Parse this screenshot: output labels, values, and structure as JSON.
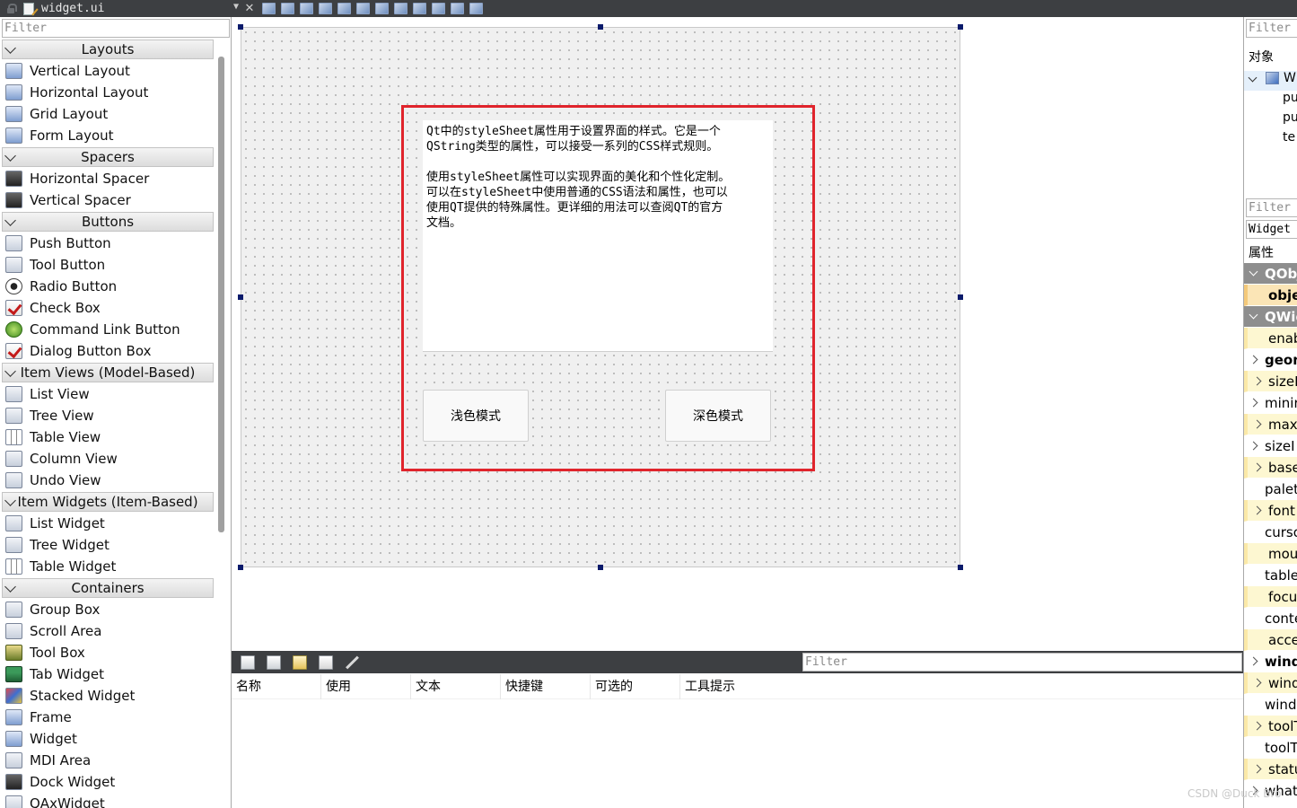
{
  "topbar": {
    "file_name": "widget.ui",
    "close_symbol": "✕"
  },
  "widget_box": {
    "filter_placeholder": "Filter",
    "categories": [
      {
        "title": "Layouts",
        "items": [
          "Vertical Layout",
          "Horizontal Layout",
          "Grid Layout",
          "Form Layout"
        ]
      },
      {
        "title": "Spacers",
        "items": [
          "Horizontal Spacer",
          "Vertical Spacer"
        ]
      },
      {
        "title": "Buttons",
        "items": [
          "Push Button",
          "Tool Button",
          "Radio Button",
          "Check Box",
          "Command Link Button",
          "Dialog Button Box"
        ]
      },
      {
        "title": "Item Views (Model-Based)",
        "items": [
          "List View",
          "Tree View",
          "Table View",
          "Column View",
          "Undo View"
        ]
      },
      {
        "title": "Item Widgets (Item-Based)",
        "items": [
          "List Widget",
          "Tree Widget",
          "Table Widget"
        ]
      },
      {
        "title": "Containers",
        "items": [
          "Group Box",
          "Scroll Area",
          "Tool Box",
          "Tab Widget",
          "Stacked Widget",
          "Frame",
          "Widget",
          "MDI Area",
          "Dock Widget",
          "QAxWidget"
        ]
      }
    ]
  },
  "form": {
    "text_content": "Qt中的styleSheet属性用于设置界面的样式。它是一个\nQString类型的属性，可以接受一系列的CSS样式规则。\n\n使用styleSheet属性可以实现界面的美化和个性化定制。\n可以在styleSheet中使用普通的CSS语法和属性，也可以\n使用QT提供的特殊属性。更详细的用法可以查阅QT的官方\n文档。",
    "light_button": "浅色模式",
    "dark_button": "深色模式",
    "highlight_color": "#e0242c"
  },
  "action_editor": {
    "filter_placeholder": "Filter",
    "columns": [
      "名称",
      "使用",
      "文本",
      "快捷键",
      "可选的",
      "工具提示"
    ]
  },
  "object_inspector": {
    "filter_placeholder": "Filter",
    "header": "对象",
    "rows": [
      "W",
      "pu",
      "pu",
      "te"
    ]
  },
  "property_editor": {
    "filter_placeholder": "Filter",
    "class_name": "Widget",
    "header": "属性",
    "rows": [
      {
        "label": "QObj",
        "kind": "group"
      },
      {
        "label": "obje",
        "kind": "orange"
      },
      {
        "label": "QWid",
        "kind": "group"
      },
      {
        "label": "enab",
        "kind": "yellow"
      },
      {
        "label": "geon",
        "kind": "bold-expand"
      },
      {
        "label": "sizeP",
        "kind": "yellow-expand"
      },
      {
        "label": "minir",
        "kind": "expand"
      },
      {
        "label": "maxi",
        "kind": "yellow-expand"
      },
      {
        "label": "sizeI",
        "kind": "expand"
      },
      {
        "label": "base",
        "kind": "yellow-expand"
      },
      {
        "label": "palet",
        "kind": "plain"
      },
      {
        "label": "font",
        "kind": "yellow-expand"
      },
      {
        "label": "curso",
        "kind": "plain"
      },
      {
        "label": "mous",
        "kind": "yellow"
      },
      {
        "label": "table",
        "kind": "plain"
      },
      {
        "label": "focus",
        "kind": "yellow"
      },
      {
        "label": "conte",
        "kind": "plain"
      },
      {
        "label": "accep",
        "kind": "yellow"
      },
      {
        "label": "wind",
        "kind": "bold-expand"
      },
      {
        "label": "wind",
        "kind": "yellow-expand"
      },
      {
        "label": "wind",
        "kind": "plain"
      },
      {
        "label": "toolT",
        "kind": "yellow-expand"
      },
      {
        "label": "toolT",
        "kind": "plain"
      },
      {
        "label": "statu",
        "kind": "yellow-expand"
      },
      {
        "label": "what",
        "kind": "expand"
      }
    ]
  },
  "watermark": "CSDN @Duck Bro"
}
